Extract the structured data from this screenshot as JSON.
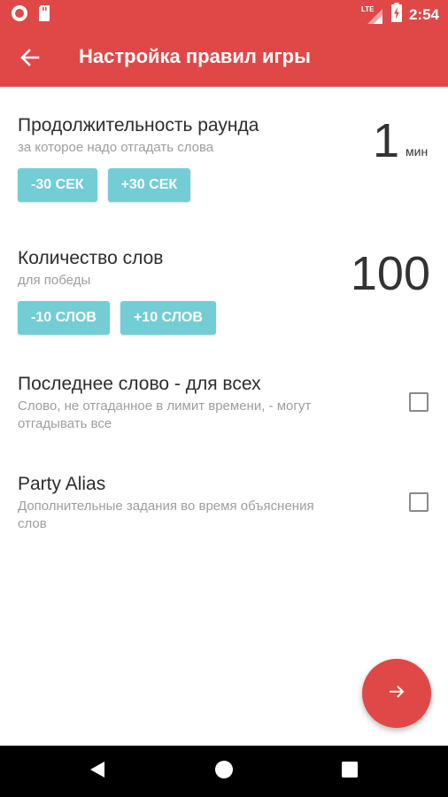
{
  "status_bar": {
    "time": "2:54",
    "network_label": "LTE",
    "icons": [
      "record-icon",
      "sd-card-icon",
      "signal-icon",
      "battery-charging-icon"
    ]
  },
  "toolbar": {
    "title": "Настройка правил игры",
    "back_icon": "arrow-left-icon"
  },
  "round_duration": {
    "title": "Продолжительность раунда",
    "subtitle": "за которое надо отгадать слова",
    "value": "1",
    "unit": "мин",
    "decrease_label": "-30 СЕК",
    "increase_label": "+30 СЕК"
  },
  "word_count": {
    "title": "Количество слов",
    "subtitle": "для победы",
    "value": "100",
    "decrease_label": "-10 СЛОВ",
    "increase_label": "+10 СЛОВ"
  },
  "last_word": {
    "title": "Последнее слово - для всех",
    "subtitle": "Слово, не отгаданное в лимит времени, - могут отгадывать все",
    "checked": false
  },
  "party_alias": {
    "title": "Party Alias",
    "subtitle": "Дополнительные задания во время объяснения слов",
    "checked": false
  },
  "fab": {
    "icon": "arrow-right-icon"
  },
  "nav_bar": {
    "icons": [
      "back-triangle-icon",
      "home-circle-icon",
      "recents-square-icon"
    ]
  },
  "colors": {
    "primary": "#e04848",
    "accent_button": "#73cdd4",
    "text_primary": "#2d2d2d",
    "text_secondary": "#9e9e9e"
  }
}
